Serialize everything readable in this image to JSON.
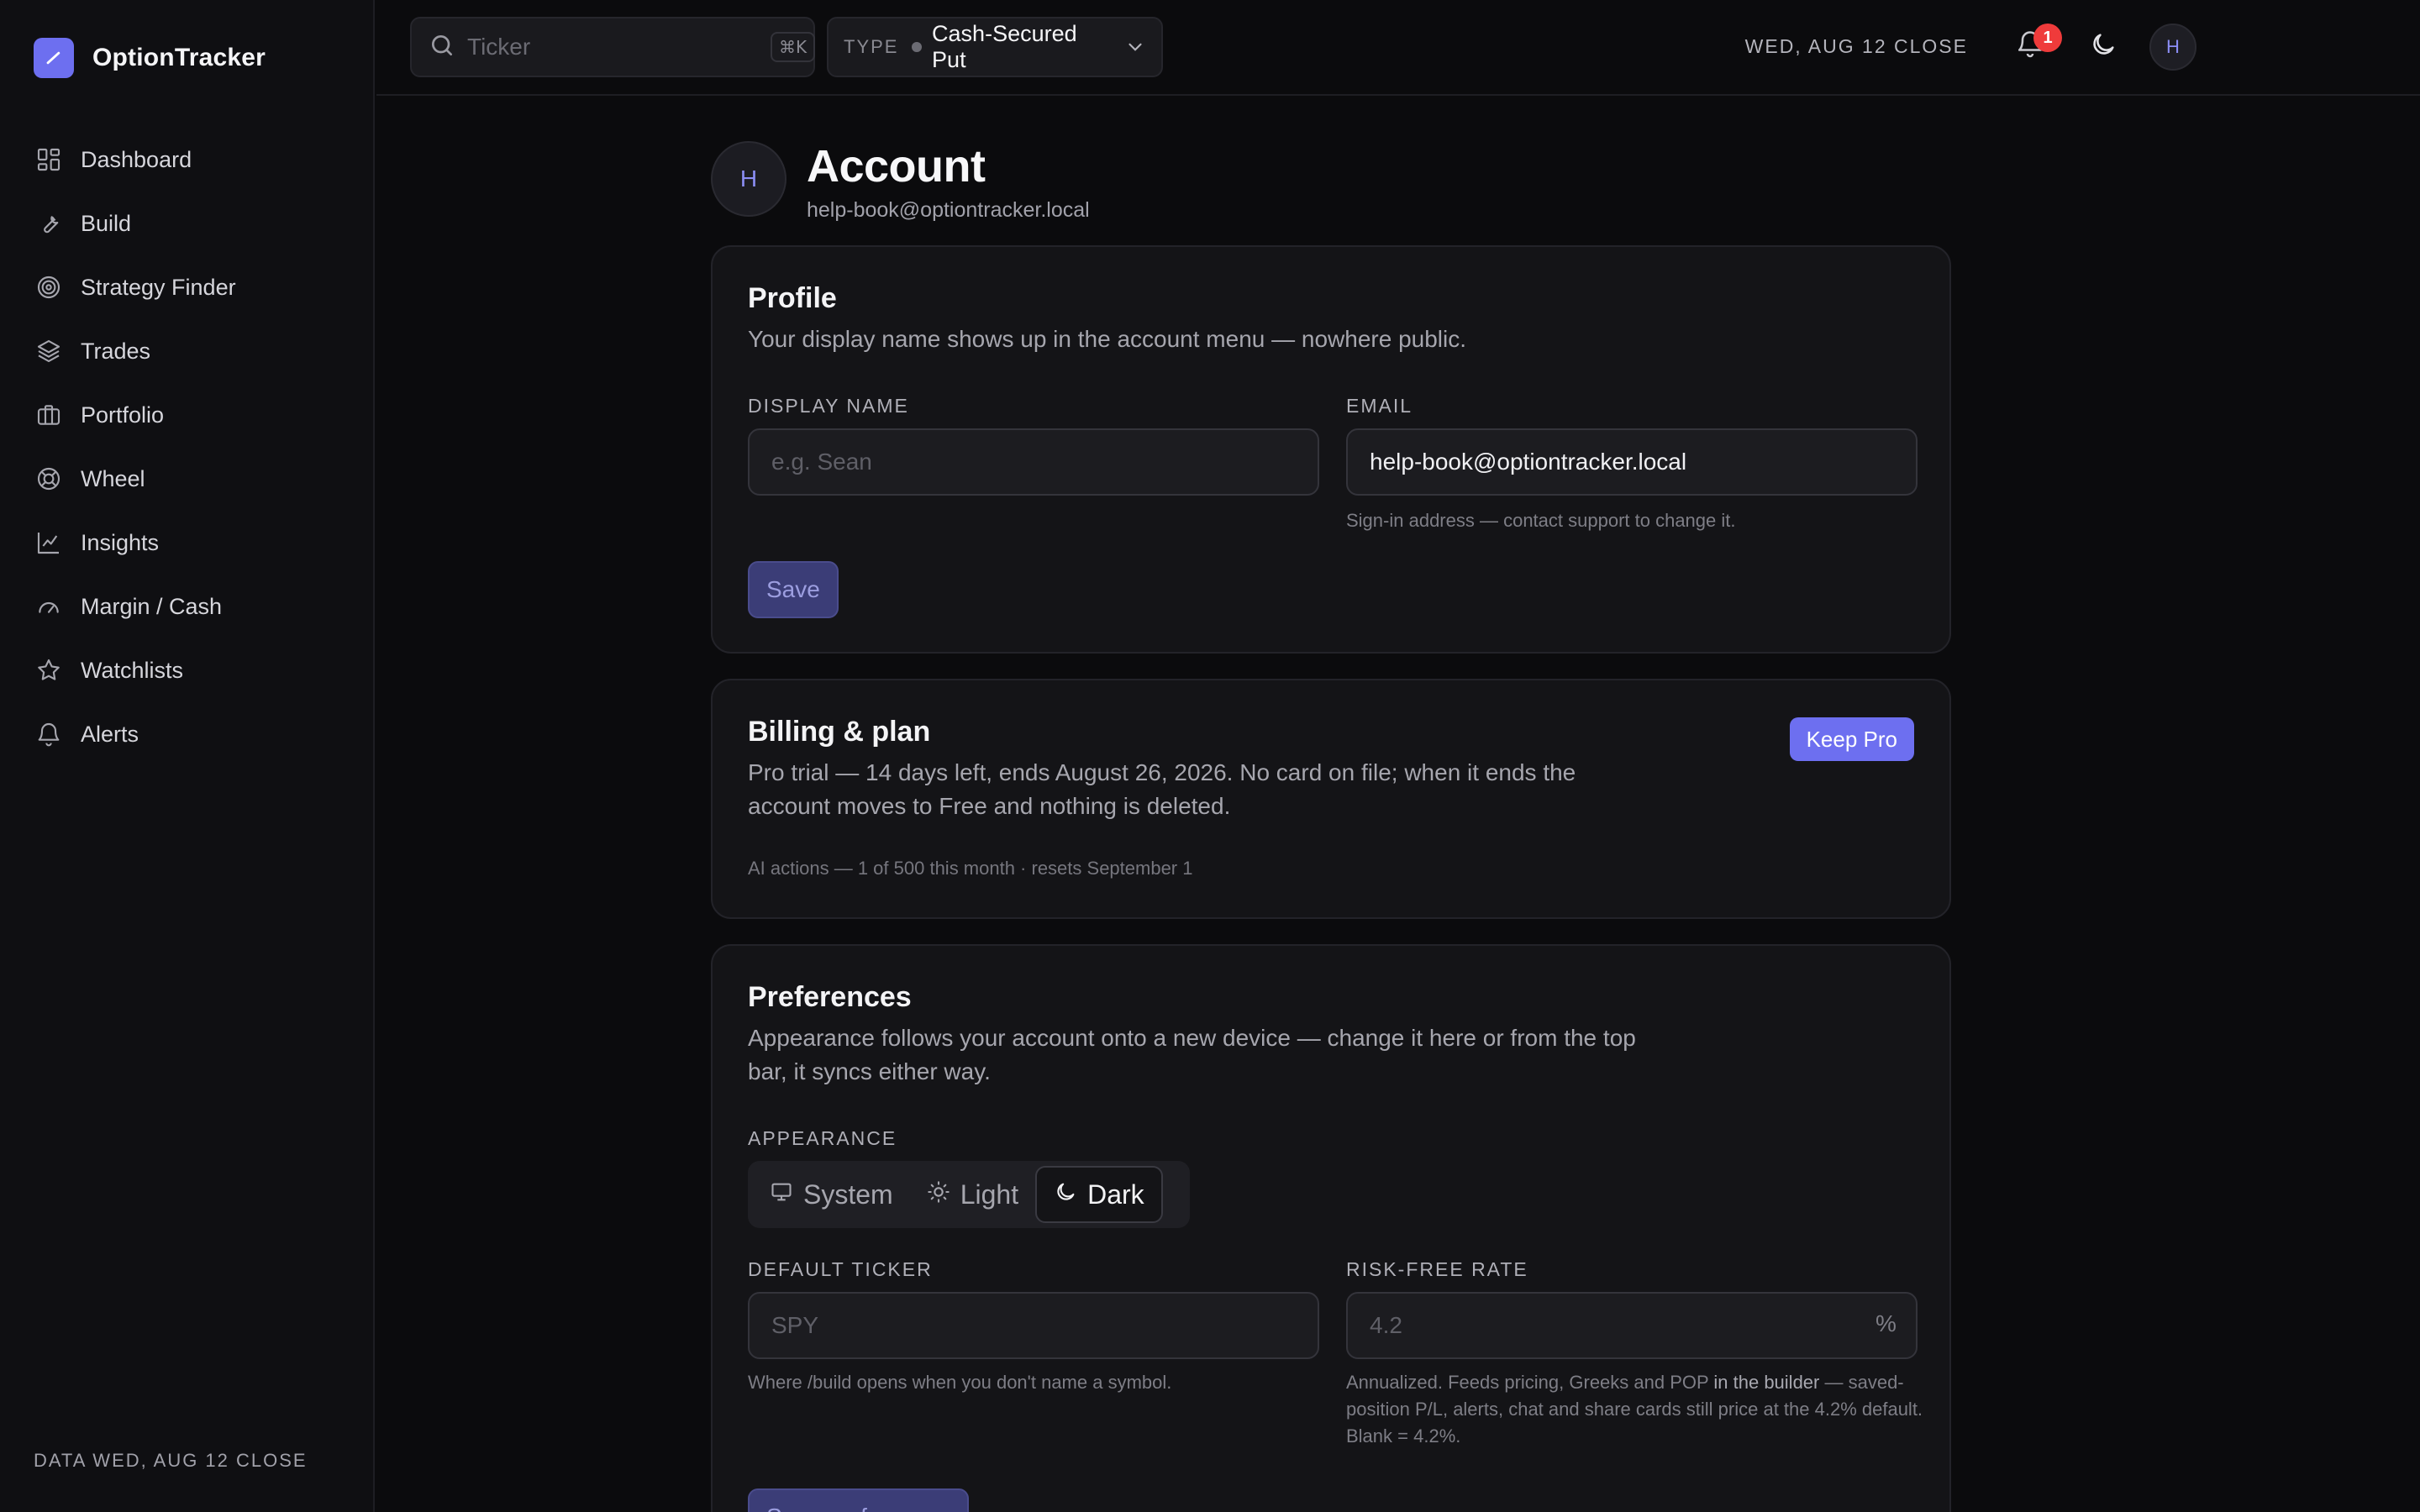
{
  "app": {
    "name": "OptionTracker",
    "accent": "#6d6ff0",
    "logo_icon": "chart-line-icon"
  },
  "sidebar": {
    "items": [
      {
        "label": "Dashboard",
        "icon": "grid-icon"
      },
      {
        "label": "Build",
        "icon": "wrench-icon"
      },
      {
        "label": "Strategy Finder",
        "icon": "target-icon"
      },
      {
        "label": "Trades",
        "icon": "layers-icon"
      },
      {
        "label": "Portfolio",
        "icon": "briefcase-icon"
      },
      {
        "label": "Wheel",
        "icon": "lifebuoy-icon"
      },
      {
        "label": "Insights",
        "icon": "line-chart-icon"
      },
      {
        "label": "Margin / Cash",
        "icon": "gauge-icon"
      },
      {
        "label": "Watchlists",
        "icon": "star-icon"
      },
      {
        "label": "Alerts",
        "icon": "bell-icon"
      }
    ],
    "footer": "DATA WED, AUG 12 CLOSE"
  },
  "topbar": {
    "search_placeholder": "Ticker",
    "search_shortcut": "⌘K",
    "type_label": "TYPE",
    "type_value": "Cash-Secured Put",
    "date_label": "WED, AUG 12 CLOSE",
    "notification_count": "1",
    "notification_color": "#ef3b3b",
    "avatar_initial": "H"
  },
  "account": {
    "avatar_initial": "H",
    "title": "Account",
    "email": "help-book@optiontracker.local"
  },
  "profile": {
    "title": "Profile",
    "description": "Your display name shows up in the account menu — nowhere public.",
    "display_name_label": "DISPLAY NAME",
    "display_name_value": "",
    "display_name_placeholder": "e.g. Sean",
    "email_label": "EMAIL",
    "email_value": "help-book@optiontracker.local",
    "email_hint": "Sign-in address — contact support to change it.",
    "save_label": "Save"
  },
  "billing": {
    "title": "Billing & plan",
    "description": "Pro trial — 14 days left, ends August 26, 2026. No card on file; when it ends the account moves to Free and nothing is deleted.",
    "usage": "AI actions — 1 of 500 this month · resets September 1",
    "keep_pro_label": "Keep Pro"
  },
  "preferences": {
    "title": "Preferences",
    "description": "Appearance follows your account onto a new device — change it here or from the top bar, it syncs either way.",
    "appearance_label": "APPEARANCE",
    "appearance_options": [
      {
        "label": "System",
        "icon": "monitor-icon"
      },
      {
        "label": "Light",
        "icon": "sun-icon"
      },
      {
        "label": "Dark",
        "icon": "moon-icon"
      }
    ],
    "appearance_selected": "Dark",
    "default_ticker_label": "DEFAULT TICKER",
    "default_ticker_value": "",
    "default_ticker_placeholder": "SPY",
    "default_ticker_hint": "Where /build opens when you don't name a symbol.",
    "risk_free_label": "RISK-FREE RATE",
    "risk_free_value": "",
    "risk_free_placeholder": "4.2",
    "risk_free_unit": "%",
    "risk_free_hint_a": "Annualized. Feeds pricing, Greeks and POP ",
    "risk_free_hint_b": "in the builder",
    "risk_free_hint_c": " — saved-position P/L, alerts, chat and share cards still price at the 4.2% default. Blank = 4.2%.",
    "save_label": "Save preferences"
  }
}
